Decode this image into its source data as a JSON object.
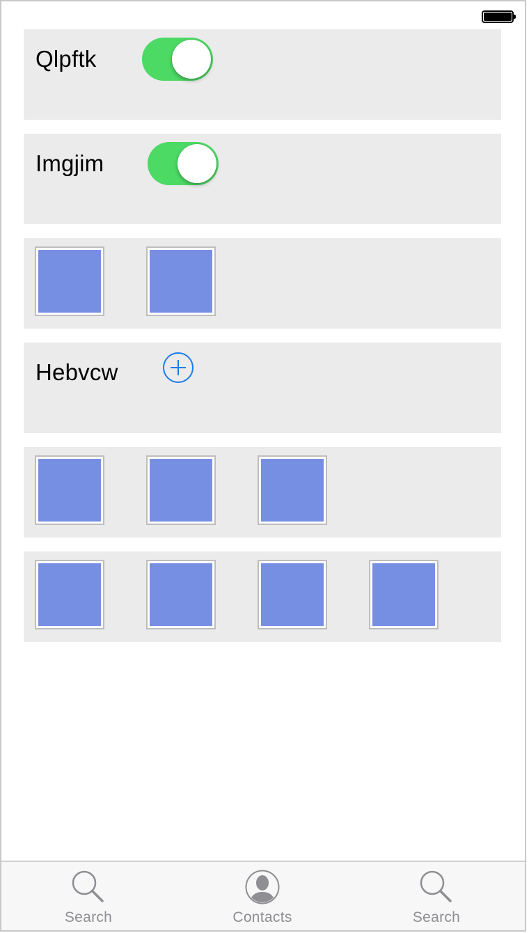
{
  "rows": [
    {
      "type": "toggle",
      "label": "Qlpftk",
      "toggle_on": true
    },
    {
      "type": "toggle",
      "label": "Imgjim",
      "toggle_on": true
    },
    {
      "type": "tiles",
      "tile_count": 2
    },
    {
      "type": "add",
      "label": "Hebvcw",
      "icon": "plus-circle-icon"
    },
    {
      "type": "tiles",
      "tile_count": 3
    },
    {
      "type": "tiles",
      "tile_count": 4
    }
  ],
  "tab_bar": {
    "items": [
      {
        "label": "Search",
        "icon": "search-icon"
      },
      {
        "label": "Contacts",
        "icon": "contacts-icon"
      },
      {
        "label": "Search",
        "icon": "search-icon"
      }
    ]
  },
  "colors": {
    "toggle_on": "#4cd964",
    "tile_fill": "#778fe3",
    "accent": "#1a7cf0",
    "row_background": "#ebebeb",
    "tab_label": "#8e8e93"
  }
}
